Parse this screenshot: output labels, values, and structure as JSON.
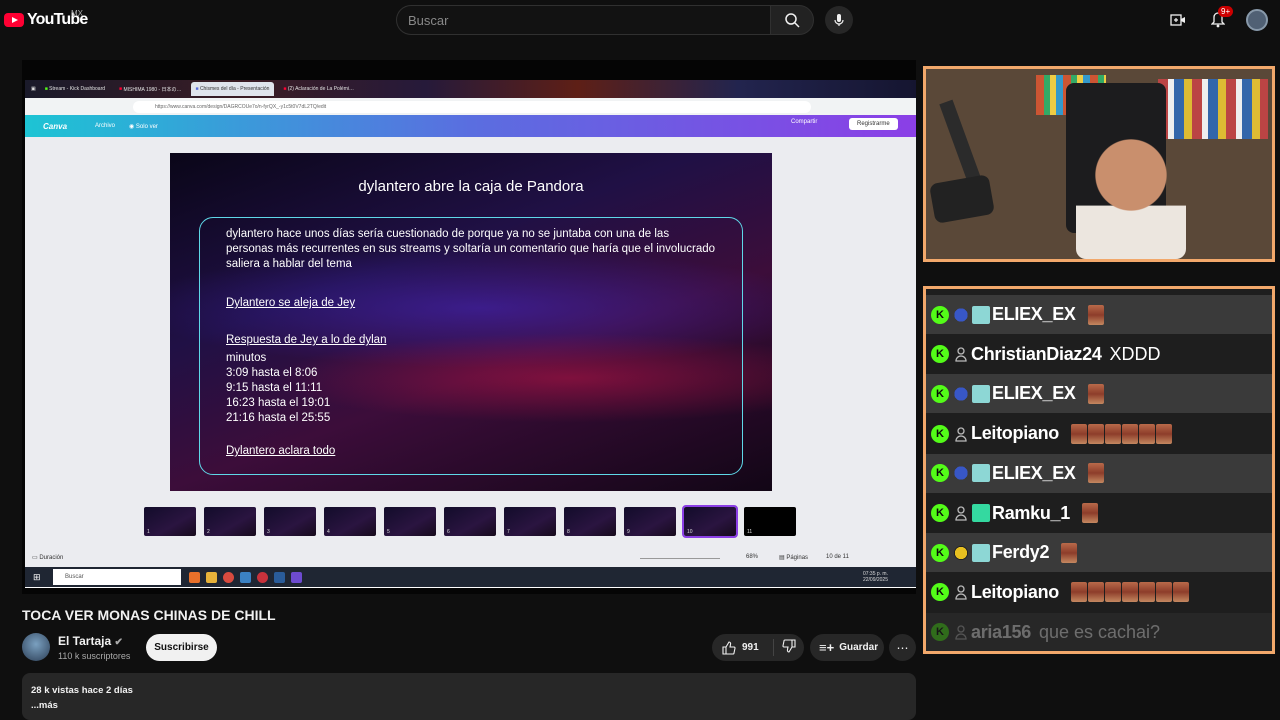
{
  "youtube": {
    "logo_text": "YouTube",
    "country": "MX",
    "search_placeholder": "Buscar",
    "notifications_count": "9+"
  },
  "browser": {
    "tabs": [
      "Stream - Kick Dashboard",
      "MISHIMA 1980 - 日本の…",
      "Chismes del día - Presentación",
      "(2) Aclaración de La Polémi…"
    ],
    "url": "https://www.canva.com/design/DAGRCOUe7o/n-fyrQX_-y1c5t0V7dL2TQ/edit"
  },
  "canva": {
    "logo": "Canva",
    "menu": [
      "Archivo",
      "Solo ver"
    ],
    "share": "Compartir",
    "register": "Registrarme",
    "duration_label": "Duración",
    "zoom": "68%",
    "pages_label": "Páginas",
    "page_counter": "10 de 11",
    "thumbnails": [
      "1",
      "2",
      "3",
      "4",
      "5",
      "6",
      "7",
      "8",
      "9",
      "10",
      "11"
    ]
  },
  "slide": {
    "title": "dylantero abre la caja de Pandora",
    "paragraph": "dylantero hace unos días sería cuestionado de porque ya no se juntaba con una de las personas más recurrentes en sus streams y soltaría un comentario que haría que el involucrado saliera a hablar del tema",
    "link1": "Dylantero se aleja de Jey",
    "link2": "Respuesta de Jey a lo de dylan",
    "minutes_label": "minutos",
    "times": [
      "3:09 hasta el 8:06",
      "9:15 hasta el 11:11",
      "16:23 hasta el 19:01",
      "21:16 hasta el 25:55"
    ],
    "link3": "Dylantero aclara todo"
  },
  "taskbar": {
    "search": "Buscar",
    "time": "07:35 p. m.",
    "date": "22/09/2025"
  },
  "video": {
    "title": "TOCA VER MONAS CHINAS DE CHILL",
    "channel": "El Tartaja",
    "subscribers": "110 k suscriptores",
    "subscribe": "Suscribirse",
    "likes": "991",
    "save": "Guardar",
    "views_date": "28 k vistas  hace 2 días",
    "more": "...más"
  },
  "chat": [
    {
      "user": "ELIEX_EX",
      "badge": "sonic",
      "gift": true,
      "message": "",
      "emotes": 1,
      "alt": true
    },
    {
      "user": "ChristianDiaz24",
      "badge": "person",
      "gift": false,
      "message": "XDDD",
      "emotes": 0,
      "alt": false
    },
    {
      "user": "ELIEX_EX",
      "badge": "sonic",
      "gift": true,
      "message": "",
      "emotes": 1,
      "alt": true
    },
    {
      "user": "Leitopiano",
      "badge": "person",
      "gift": false,
      "message": "",
      "emotes": 6,
      "alt": false
    },
    {
      "user": "ELIEX_EX",
      "badge": "sonic",
      "gift": true,
      "message": "",
      "emotes": 1,
      "alt": true
    },
    {
      "user": "Ramku_1",
      "badge": "person",
      "gift": "green",
      "message": "",
      "emotes": 1,
      "alt": false
    },
    {
      "user": "Ferdy2",
      "badge": "ferdy",
      "gift": true,
      "message": "",
      "emotes": 1,
      "alt": true
    },
    {
      "user": "Leitopiano",
      "badge": "person",
      "gift": false,
      "message": "",
      "emotes": 7,
      "alt": false
    },
    {
      "user": "aria156",
      "badge": "person",
      "gift": false,
      "message": "que es cachai?",
      "emotes": 0,
      "alt": true,
      "faded": true
    }
  ],
  "colors": {
    "yt_red": "#ff0033",
    "kick_green": "#53fc18",
    "overlay_border": "#f2a86b"
  }
}
